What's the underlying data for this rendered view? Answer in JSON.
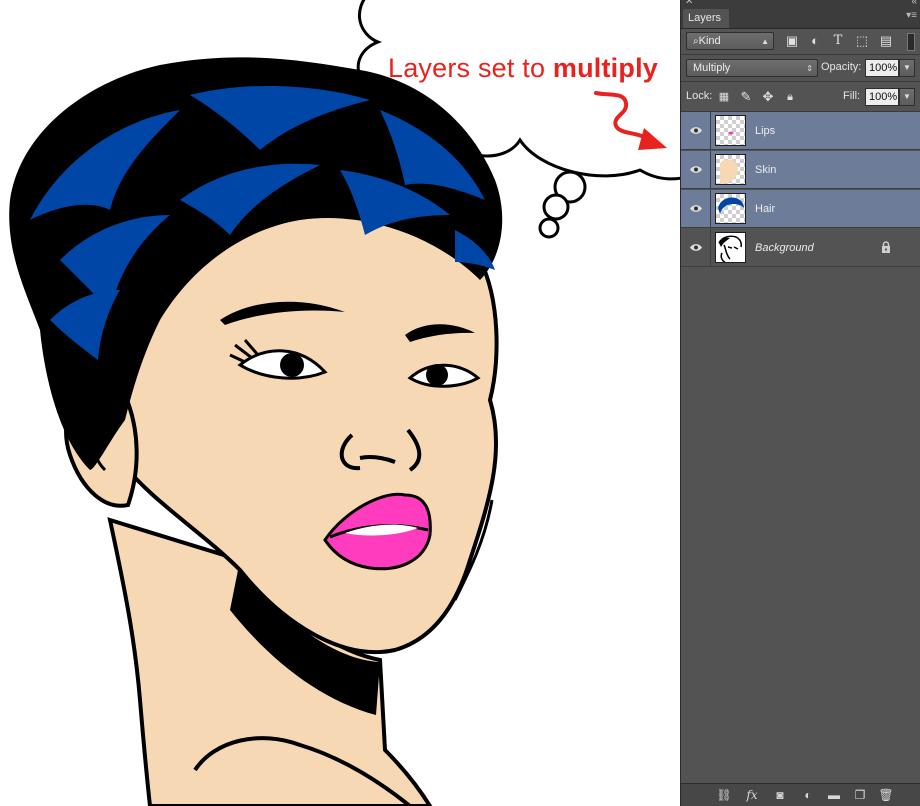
{
  "canvas": {
    "callout_text": "Layers set to ",
    "callout_bold": "multiply",
    "colors": {
      "hair": "#0046a6",
      "skin": "#f6d9b4",
      "lips": "#ff3cbe",
      "line": "#000000",
      "arrow": "#e8231f"
    }
  },
  "panel": {
    "tab_label": "Layers",
    "filter": {
      "kind_label": "Kind"
    },
    "blend_mode": {
      "value": "Multiply"
    },
    "opacity": {
      "label": "Opacity:",
      "value": "100%"
    },
    "lock": {
      "label": "Lock:"
    },
    "fill": {
      "label": "Fill:",
      "value": "100%"
    },
    "layers": [
      {
        "name": "Lips",
        "selected": true,
        "visible": true
      },
      {
        "name": "Skin",
        "selected": true,
        "visible": true
      },
      {
        "name": "Hair",
        "selected": true,
        "visible": true
      },
      {
        "name": "Background",
        "selected": false,
        "visible": true,
        "locked": true
      }
    ],
    "colors": {
      "panel_bg": "#535353",
      "selected_row": "#6d7d99",
      "field_bg": "#ededed"
    }
  }
}
